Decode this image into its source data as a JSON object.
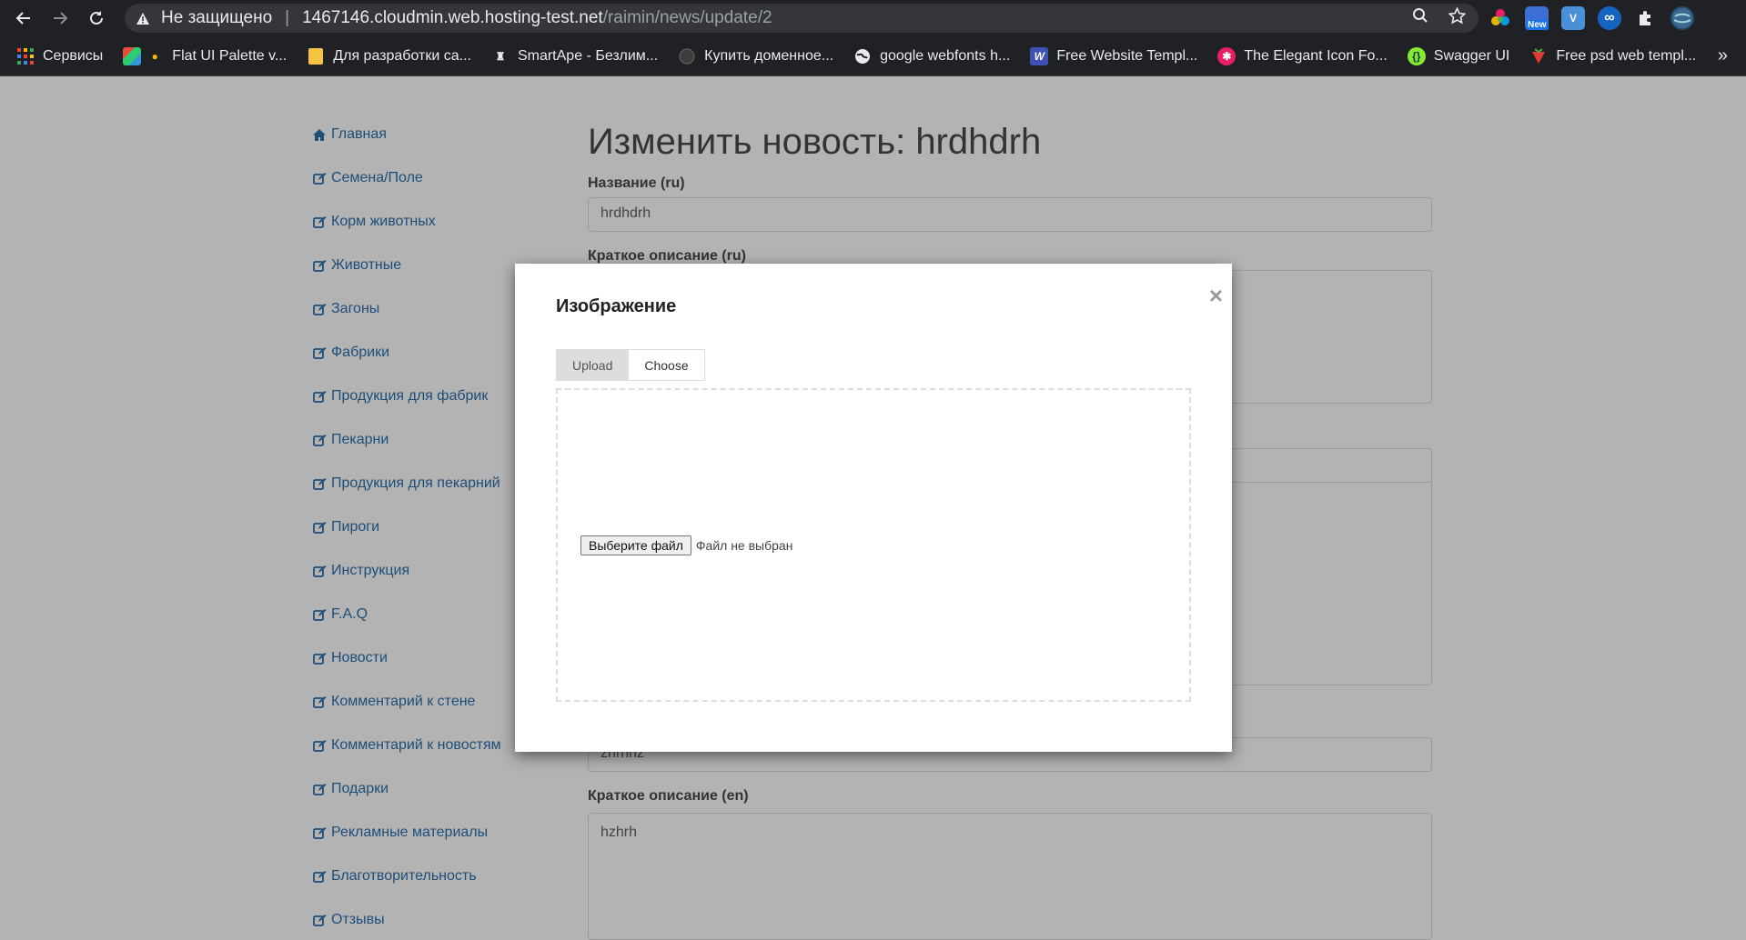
{
  "browser": {
    "insecure_label": "Не защищено",
    "url_host": "1467146.cloudmin.web.hosting-test.net",
    "url_path": "/raimin/news/update/2",
    "extensions": [
      {
        "name": "color-ext-icon",
        "color": "#e91e63"
      },
      {
        "name": "new-ext-icon",
        "label": "New",
        "color": "#1a73e8"
      },
      {
        "name": "v-ext-icon",
        "label": "V",
        "color": "#4a90d9"
      },
      {
        "name": "link-ext-icon",
        "label": "∞",
        "color": "#1565c0"
      },
      {
        "name": "puzzle-icon"
      },
      {
        "name": "profile-avatar"
      }
    ]
  },
  "bookmarks": [
    {
      "label": "Сервисы",
      "icon": "apps-grid-icon",
      "color": "#e94235"
    },
    {
      "label": "Flat UI Palette v...",
      "icon": "palette-icon",
      "color": "#f4b400"
    },
    {
      "label": "Для разработки са...",
      "icon": "folder-icon",
      "color": "#f6c343"
    },
    {
      "label": "SmartApe - Безлим...",
      "icon": "smartape-icon",
      "color": "#e8eaed"
    },
    {
      "label": "Купить доменное...",
      "icon": "domain-icon",
      "color": "#555"
    },
    {
      "label": "google webfonts h...",
      "icon": "globe-icon",
      "color": "#e8eaed"
    },
    {
      "label": "Free Website Templ...",
      "icon": "w-icon",
      "color": "#3f51b5"
    },
    {
      "label": "The Elegant Icon Fo...",
      "icon": "star-badge-icon",
      "color": "#e91e63"
    },
    {
      "label": "Swagger UI",
      "icon": "swagger-icon",
      "color": "#85ea2d"
    },
    {
      "label": "Free psd web templ...",
      "icon": "strawberry-icon",
      "color": "#e53935"
    }
  ],
  "sidebar": {
    "items": [
      {
        "label": "Главная",
        "icon": "home-icon"
      },
      {
        "label": "Семена/Поле",
        "icon": "edit-icon"
      },
      {
        "label": "Корм животных",
        "icon": "edit-icon"
      },
      {
        "label": "Животные",
        "icon": "edit-icon"
      },
      {
        "label": "Загоны",
        "icon": "edit-icon"
      },
      {
        "label": "Фабрики",
        "icon": "edit-icon"
      },
      {
        "label": "Продукция для фабрик",
        "icon": "edit-icon"
      },
      {
        "label": "Пекарни",
        "icon": "edit-icon"
      },
      {
        "label": "Продукция для пекарний",
        "icon": "edit-icon"
      },
      {
        "label": "Пироги",
        "icon": "edit-icon"
      },
      {
        "label": "Инструкция",
        "icon": "edit-icon"
      },
      {
        "label": "F.A.Q",
        "icon": "edit-icon"
      },
      {
        "label": "Новости",
        "icon": "edit-icon"
      },
      {
        "label": "Комментарий к стене",
        "icon": "edit-icon"
      },
      {
        "label": "Комментарий к новостям",
        "icon": "edit-icon"
      },
      {
        "label": "Подарки",
        "icon": "edit-icon"
      },
      {
        "label": "Рекламные материалы",
        "icon": "edit-icon"
      },
      {
        "label": "Благотворительность",
        "icon": "edit-icon"
      },
      {
        "label": "Отзывы",
        "icon": "edit-icon"
      }
    ]
  },
  "main": {
    "title": "Изменить новость: hrdhdrh",
    "name_ru_label": "Название (ru)",
    "name_ru_value": "hrdhdrh",
    "short_ru_label": "Краткое описание (ru)",
    "name_en_value": "zhrhhz",
    "short_en_label": "Краткое описание (en)",
    "short_en_value": "hzhrh"
  },
  "modal": {
    "title": "Изображение",
    "close": "×",
    "tab_upload": "Upload",
    "tab_choose": "Choose",
    "file_button": "Выберите файл",
    "file_status": "Файл не выбран"
  }
}
